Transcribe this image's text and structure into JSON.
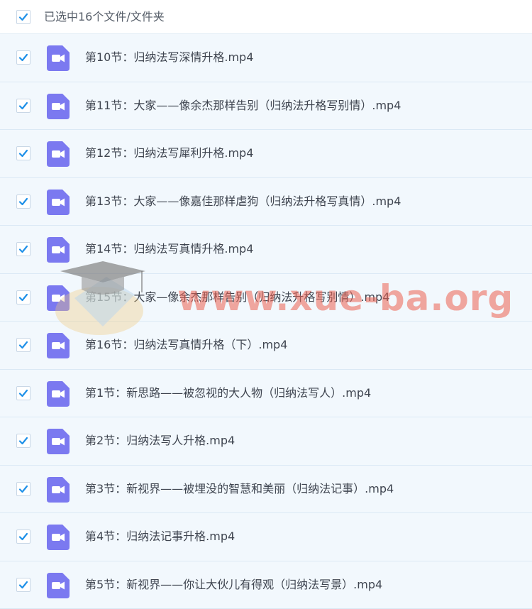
{
  "header": {
    "selection_text": "已选中16个文件/文件夹"
  },
  "files": [
    {
      "name": "第10节：归纳法写深情升格.mp4",
      "icon": "video-file-icon"
    },
    {
      "name": "第11节：大家——像余杰那样告别（归纳法升格写别情）.mp4",
      "icon": "video-file-icon"
    },
    {
      "name": "第12节：归纳法写犀利升格.mp4",
      "icon": "video-file-icon"
    },
    {
      "name": "第13节：大家——像嘉佳那样虐狗（归纳法升格写真情）.mp4",
      "icon": "video-file-icon"
    },
    {
      "name": "第14节：归纳法写真情升格.mp4",
      "icon": "video-file-icon"
    },
    {
      "name": "第15节：大家—像余杰那样告别（归纳法升格写别情）.mp4",
      "icon": "video-file-icon"
    },
    {
      "name": "第16节：归纳法写真情升格（下）.mp4",
      "icon": "video-file-icon"
    },
    {
      "name": "第1节：新思路——被忽视的大人物（归纳法写人）.mp4",
      "icon": "video-file-icon"
    },
    {
      "name": "第2节：归纳法写人升格.mp4",
      "icon": "video-file-icon"
    },
    {
      "name": "第3节：新视界——被埋没的智慧和美丽（归纳法记事）.mp4",
      "icon": "video-file-icon"
    },
    {
      "name": "第4节：归纳法记事升格.mp4",
      "icon": "video-file-icon"
    },
    {
      "name": "第5节：新视界——你让大伙儿有得观（归纳法写景）.mp4",
      "icon": "video-file-icon"
    }
  ],
  "watermark": {
    "text": "www.xue-ba.org"
  },
  "colors": {
    "checkbox_check": "#1e90e8",
    "file_icon_bg": "#7b79f0",
    "row_bg": "#f2f8fd"
  }
}
